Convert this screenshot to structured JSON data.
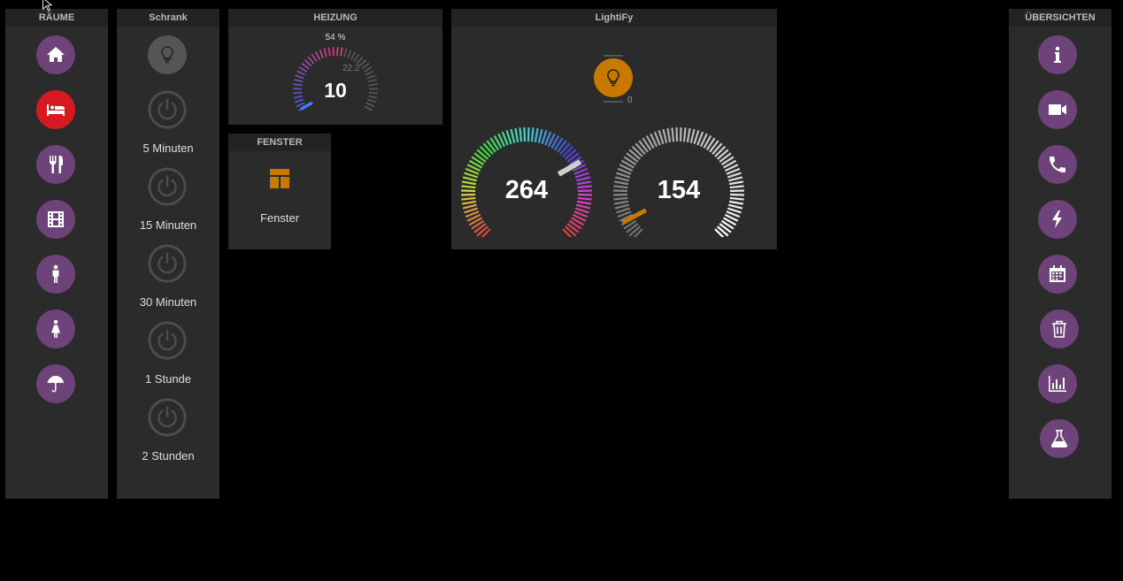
{
  "raeume": {
    "title": "RÄUME",
    "items": [
      {
        "icon": "home-icon"
      },
      {
        "icon": "bed-icon",
        "active": true
      },
      {
        "icon": "utensils-icon"
      },
      {
        "icon": "film-icon"
      },
      {
        "icon": "male-icon"
      },
      {
        "icon": "female-icon"
      },
      {
        "icon": "umbrella-icon"
      }
    ]
  },
  "schrank": {
    "title": "Schrank",
    "bulb_icon": "lightbulb-icon",
    "timers": [
      "5 Minuten",
      "15 Minuten",
      "30 Minuten",
      "1 Stunde",
      "2 Stunden"
    ]
  },
  "heizung": {
    "title": "HEIZUNG",
    "percent": "54 %",
    "setpoint": "10",
    "actual": "22.2",
    "level": 0.54
  },
  "fenster": {
    "title": "FENSTER",
    "icon": "window-icon",
    "label": "Fenster",
    "accent": "#c87a00"
  },
  "lightify": {
    "title": "LightiFy",
    "bulb_icon": "lightbulb-icon",
    "brightness": "0",
    "hue": "264",
    "white": "154",
    "accent": "#c87a00"
  },
  "uebersichten": {
    "title": "ÜBERSICHTEN",
    "items": [
      {
        "icon": "info-icon"
      },
      {
        "icon": "video-camera-icon"
      },
      {
        "icon": "phone-icon"
      },
      {
        "icon": "lightning-icon"
      },
      {
        "icon": "calendar-icon"
      },
      {
        "icon": "trash-icon"
      },
      {
        "icon": "bar-chart-icon"
      },
      {
        "icon": "flask-icon"
      }
    ]
  },
  "colors": {
    "button": "#6e437a",
    "active": "#d71920",
    "panel": "#2b2b2b"
  }
}
